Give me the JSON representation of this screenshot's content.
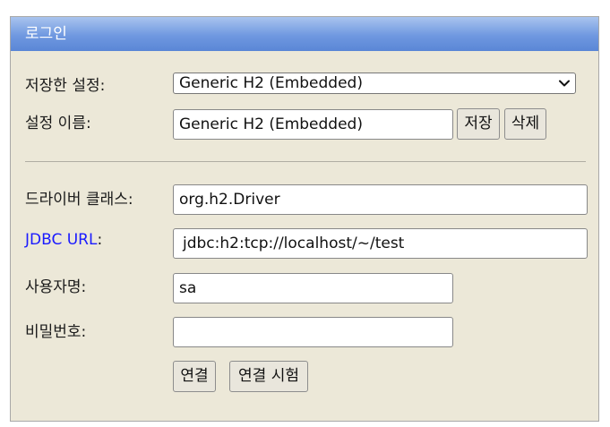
{
  "title": "로그인",
  "saved_settings": {
    "label": "저장한 설정:",
    "selected": "Generic H2 (Embedded)"
  },
  "setting_name": {
    "label": "설정 이름:",
    "value": "Generic H2 (Embedded)",
    "save_button": "저장",
    "delete_button": "삭제"
  },
  "driver_class": {
    "label": "드라이버 클래스:",
    "value": "org.h2.Driver"
  },
  "jdbc_url": {
    "label_link": "JDBC URL",
    "label_suffix": ":",
    "value": "jdbc:h2:tcp://localhost/~/test"
  },
  "username": {
    "label": "사용자명:",
    "value": "sa"
  },
  "password": {
    "label": "비밀번호:",
    "value": ""
  },
  "actions": {
    "connect_button": "연결",
    "test_connection_button": "연결 시험"
  },
  "colors": {
    "panel_background": "#ece8d8",
    "titlebar": "#6f98e0",
    "link": "#1a1aff"
  },
  "icons": {
    "select_arrow": "chevron-down-icon"
  }
}
